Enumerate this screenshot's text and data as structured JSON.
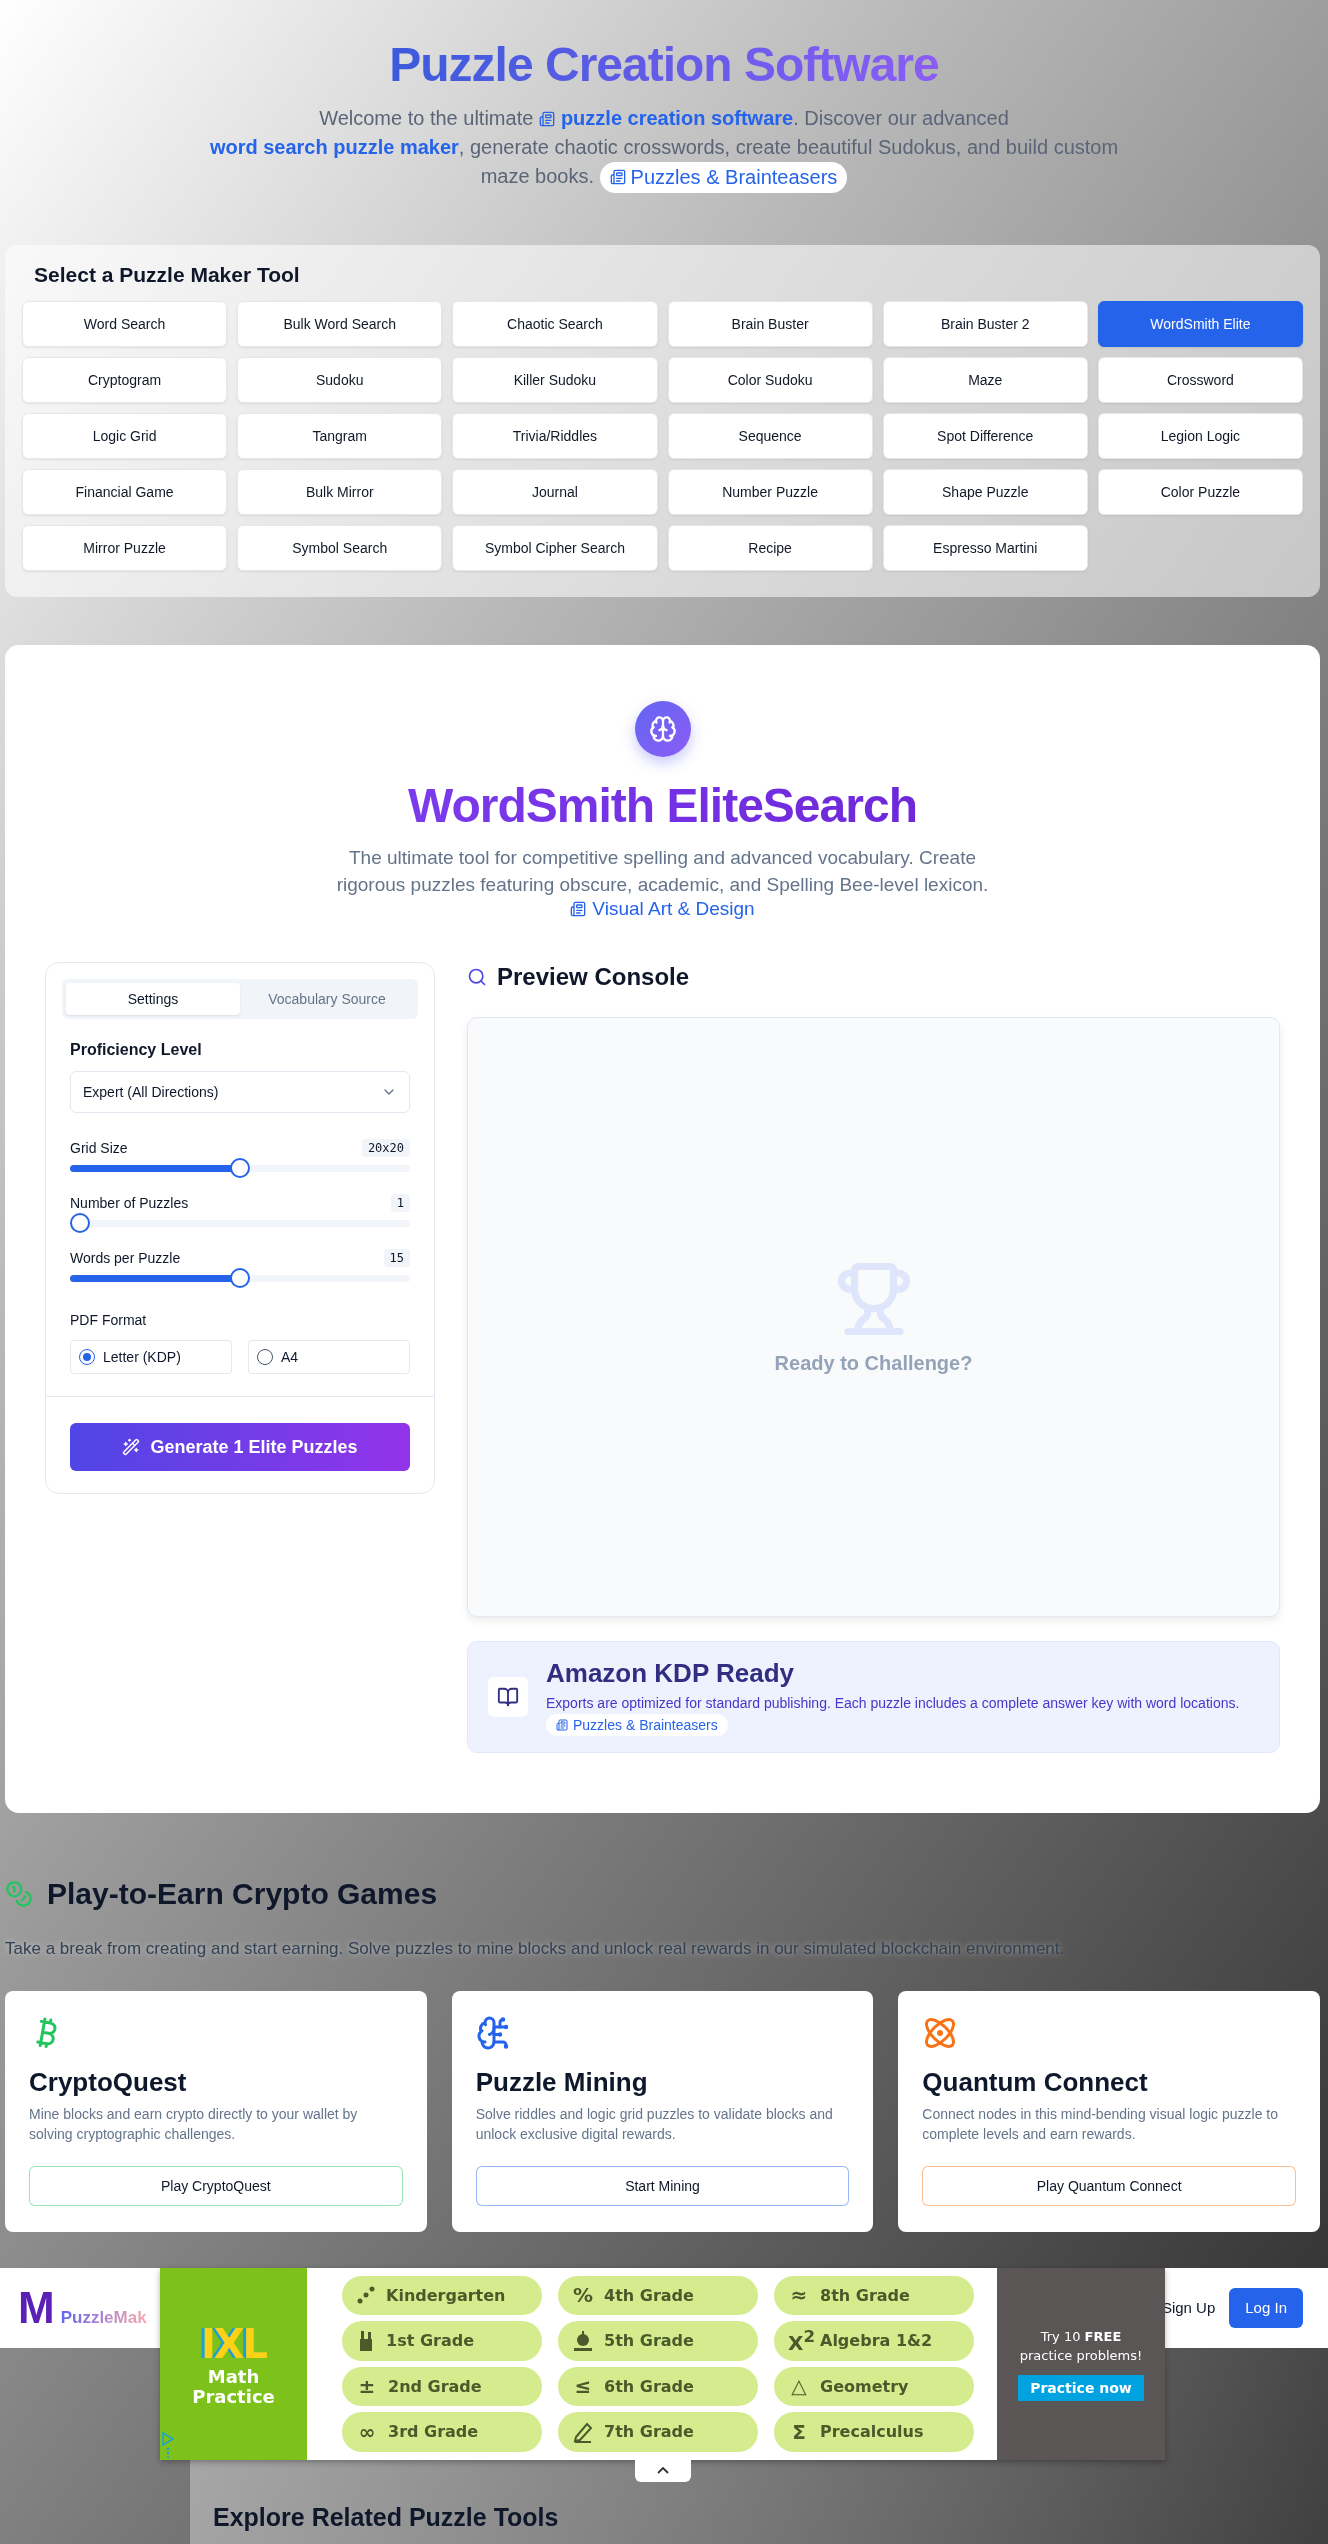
{
  "header": {
    "title": "Puzzle Creation Software",
    "intro": [
      {
        "kind": "text",
        "text": "Welcome to the ultimate "
      },
      {
        "kind": "link",
        "text": "puzzle creation software",
        "icon": true
      },
      {
        "kind": "text",
        "text": ". Discover our advanced "
      },
      {
        "kind": "link",
        "text": "word search puzzle maker",
        "icon": false
      },
      {
        "kind": "text",
        "text": ", generate chaotic crosswords, create beautiful Sudokus, and build custom maze books. "
      },
      {
        "kind": "chip",
        "text": "Puzzles & Brainteasers"
      }
    ]
  },
  "tool_picker": {
    "title": "Select a Puzzle Maker Tool",
    "tools": [
      {
        "label": "Word Search",
        "selected": false
      },
      {
        "label": "Bulk Word Search",
        "selected": false
      },
      {
        "label": "Chaotic Search",
        "selected": false
      },
      {
        "label": "Brain Buster",
        "selected": false
      },
      {
        "label": "Brain Buster 2",
        "selected": false
      },
      {
        "label": "WordSmith Elite",
        "selected": true
      },
      {
        "label": "Cryptogram",
        "selected": false
      },
      {
        "label": "Sudoku",
        "selected": false
      },
      {
        "label": "Killer Sudoku",
        "selected": false
      },
      {
        "label": "Color Sudoku",
        "selected": false
      },
      {
        "label": "Maze",
        "selected": false
      },
      {
        "label": "Crossword",
        "selected": false
      },
      {
        "label": "Logic Grid",
        "selected": false
      },
      {
        "label": "Tangram",
        "selected": false
      },
      {
        "label": "Trivia/Riddles",
        "selected": false
      },
      {
        "label": "Sequence",
        "selected": false
      },
      {
        "label": "Spot Difference",
        "selected": false
      },
      {
        "label": "Legion Logic",
        "selected": false
      },
      {
        "label": "Financial Game",
        "selected": false
      },
      {
        "label": "Bulk Mirror",
        "selected": false
      },
      {
        "label": "Journal",
        "selected": false
      },
      {
        "label": "Number Puzzle",
        "selected": false
      },
      {
        "label": "Shape Puzzle",
        "selected": false
      },
      {
        "label": "Color Puzzle",
        "selected": false
      },
      {
        "label": "Mirror Puzzle",
        "selected": false
      },
      {
        "label": "Symbol Search",
        "selected": false
      },
      {
        "label": "Symbol Cipher Search",
        "selected": false
      },
      {
        "label": "Recipe",
        "selected": false
      },
      {
        "label": "Espresso Martini",
        "selected": false
      }
    ]
  },
  "tool": {
    "title": "WordSmith EliteSearch",
    "description": "The ultimate tool for competitive spelling and advanced vocabulary. Create rigorous puzzles featuring obscure, academic, and Spelling Bee-level lexicon.",
    "category_link": "Visual Art & Design",
    "tabs": [
      {
        "label": "Settings",
        "selected": true
      },
      {
        "label": "Vocabulary Source",
        "selected": false
      }
    ],
    "proficiency": {
      "label": "Proficiency Level",
      "value": "Expert (All Directions)"
    },
    "sliders": [
      {
        "label": "Grid Size",
        "reading": "20x20",
        "level": 0.5
      },
      {
        "label": "Number of Puzzles",
        "reading": "1",
        "level": 0
      },
      {
        "label": "Words per Puzzle",
        "reading": "15",
        "level": 0.5
      }
    ],
    "pdf_format": {
      "label": "PDF Format",
      "options": [
        {
          "label": "Letter (KDP)",
          "selected": true
        },
        {
          "label": "A4",
          "selected": false
        }
      ]
    },
    "generate_button": "Generate 1 Elite Puzzles",
    "preview": {
      "title": "Preview Console",
      "empty_text": "Ready to Challenge?"
    },
    "kdp": {
      "title": "Amazon KDP Ready",
      "text": "Exports are optimized for standard publishing. Each puzzle includes a complete answer key with word locations. ",
      "chip": "Puzzles & Brainteasers"
    }
  },
  "crypto": {
    "title": "Play-to-Earn Crypto Games",
    "description": "Take a break from creating and start earning. Solve puzzles to mine blocks and unlock real rewards in our simulated blockchain environment.",
    "games": [
      {
        "kind": "bitcoin",
        "color": "#22c55e",
        "title": "CryptoQuest",
        "text": "Mine blocks and earn crypto directly to your wallet by solving cryptographic challenges.",
        "button": "Play CryptoQuest"
      },
      {
        "kind": "brain",
        "color": "#2563eb",
        "title": "Puzzle Mining",
        "text": "Solve riddles and logic grid puzzles to validate blocks and unlock exclusive digital rewards.",
        "button": "Start Mining"
      },
      {
        "kind": "atom",
        "color": "#f97316",
        "title": "Quantum Connect",
        "text": "Connect nodes in this mind-bending visual logic puzzle to complete levels and earn rewards.",
        "button": "Play Quantum Connect"
      }
    ]
  },
  "navbar": {
    "logo_letter": "M",
    "logo_text": "PuzzleMak",
    "sign_up": "Sign Up",
    "log_in": "Log In"
  },
  "related": {
    "heading": "Explore Related Puzzle Tools"
  },
  "ad": {
    "logo": "IXL",
    "subtitle": "Math Practice",
    "grades": [
      {
        "label": "Kindergarten"
      },
      {
        "label": "1st Grade"
      },
      {
        "label": "2nd Grade",
        "symbol": "±"
      },
      {
        "label": "3rd Grade",
        "symbol": "∞"
      },
      {
        "label": "4th Grade",
        "symbol": "%"
      },
      {
        "label": "5th Grade"
      },
      {
        "label": "6th Grade",
        "symbol": "≤"
      },
      {
        "label": "7th Grade"
      },
      {
        "label": "8th Grade",
        "symbol": "≈"
      },
      {
        "label": "Algebra 1&2",
        "symbol": "X$^{2}$"
      },
      {
        "label": "Geometry",
        "symbol": "△"
      },
      {
        "label": "Precalculus",
        "symbol": "Σ"
      }
    ],
    "offer": "Try 10 **FREE** practice problems!",
    "cta": "Practice now"
  }
}
